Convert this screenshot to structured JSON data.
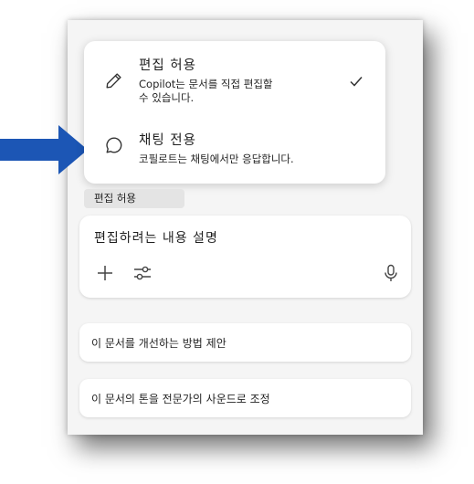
{
  "mode_menu": {
    "edit": {
      "title": "편집 허용",
      "desc_line1": "Copilot는 문서를 직접 편집할",
      "desc_line2": "수 있습니다.",
      "selected": true,
      "icon": "pencil-icon"
    },
    "chat": {
      "title": "채팅 전용",
      "desc": "코필로트는 채팅에서만 응답합니다.",
      "selected": false,
      "icon": "chat-bubble-icon"
    }
  },
  "mode_chip": {
    "label": "편집 허용"
  },
  "composer": {
    "placeholder": "편집하려는 내용 설명",
    "icons": [
      "plus-icon",
      "sliders-icon",
      "microphone-icon"
    ]
  },
  "suggestions": [
    {
      "label": "이 문서를 개선하는 방법 제안"
    },
    {
      "label": "이 문서의 톤을 전문가의 사운드로 조정"
    }
  ],
  "colors": {
    "arrow": "#1c56b5",
    "panel": "#f5f5f5",
    "card": "#ffffff"
  }
}
